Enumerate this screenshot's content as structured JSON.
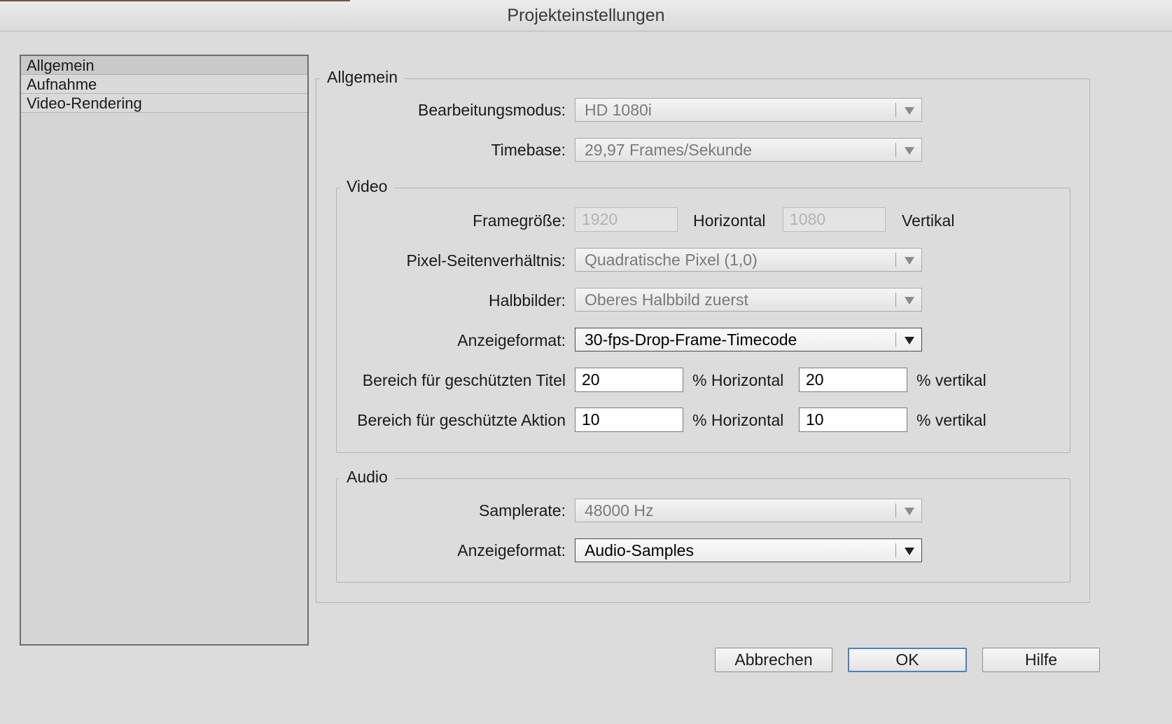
{
  "window": {
    "title": "Projekteinstellungen"
  },
  "sidebar": {
    "items": [
      {
        "label": "Allgemein",
        "selected": true
      },
      {
        "label": "Aufnahme",
        "selected": false
      },
      {
        "label": "Video-Rendering",
        "selected": false
      }
    ]
  },
  "general": {
    "legend": "Allgemein",
    "edit_mode": {
      "label": "Bearbeitungsmodus:",
      "value": "HD 1080i"
    },
    "timebase": {
      "label": "Timebase:",
      "value": "29,97 Frames/Sekunde"
    }
  },
  "video": {
    "legend": "Video",
    "frame_size": {
      "label": "Framegröße:",
      "width": "1920",
      "horizontal_label": "Horizontal",
      "height": "1080",
      "vertical_label": "Vertikal"
    },
    "pixel_aspect": {
      "label": "Pixel-Seitenverhältnis:",
      "value": "Quadratische Pixel (1,0)"
    },
    "fields": {
      "label": "Halbbilder:",
      "value": "Oberes Halbbild zuerst"
    },
    "display_format": {
      "label": "Anzeigeformat:",
      "value": "30-fps-Drop-Frame-Timecode"
    },
    "title_safe": {
      "label": "Bereich für geschützten Titel",
      "horizontal": "20",
      "horizontal_label": "% Horizontal",
      "vertical": "20",
      "vertical_label": "% vertikal"
    },
    "action_safe": {
      "label": "Bereich für geschützte Aktion",
      "horizontal": "10",
      "horizontal_label": "% Horizontal",
      "vertical": "10",
      "vertical_label": "% vertikal"
    }
  },
  "audio": {
    "legend": "Audio",
    "sample_rate": {
      "label": "Samplerate:",
      "value": "48000 Hz"
    },
    "display_format": {
      "label": "Anzeigeformat:",
      "value": "Audio-Samples"
    }
  },
  "buttons": {
    "cancel": "Abbrechen",
    "ok": "OK",
    "help": "Hilfe"
  }
}
